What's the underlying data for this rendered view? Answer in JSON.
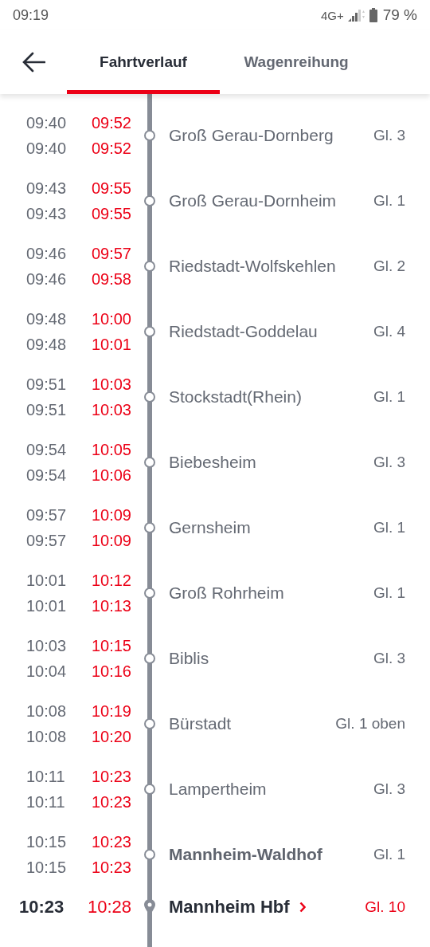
{
  "status_bar": {
    "time": "09:19",
    "network": "4G+",
    "battery": "79 %"
  },
  "tabs": [
    {
      "label": "Fahrtverlauf",
      "selected": true
    },
    {
      "label": "Wagenreihung",
      "selected": false
    }
  ],
  "stops": [
    {
      "kind": "stop",
      "arrival_planned": "09:40",
      "arrival_actual": "09:52",
      "departure_planned": "09:40",
      "departure_actual": "09:52",
      "name": "Groß Gerau-Dornberg",
      "platform": "Gl. 3",
      "platform_changed": false
    },
    {
      "kind": "stop",
      "arrival_planned": "09:43",
      "arrival_actual": "09:55",
      "departure_planned": "09:43",
      "departure_actual": "09:55",
      "name": "Groß Gerau-Dornheim",
      "platform": "Gl. 1",
      "platform_changed": false
    },
    {
      "kind": "stop",
      "arrival_planned": "09:46",
      "arrival_actual": "09:57",
      "departure_planned": "09:46",
      "departure_actual": "09:58",
      "name": "Riedstadt-Wolfskehlen",
      "platform": "Gl. 2",
      "platform_changed": false
    },
    {
      "kind": "stop",
      "arrival_planned": "09:48",
      "arrival_actual": "10:00",
      "departure_planned": "09:48",
      "departure_actual": "10:01",
      "name": "Riedstadt-Goddelau",
      "platform": "Gl. 4",
      "platform_changed": false
    },
    {
      "kind": "stop",
      "arrival_planned": "09:51",
      "arrival_actual": "10:03",
      "departure_planned": "09:51",
      "departure_actual": "10:03",
      "name": "Stockstadt(Rhein)",
      "platform": "Gl. 1",
      "platform_changed": false
    },
    {
      "kind": "stop",
      "arrival_planned": "09:54",
      "arrival_actual": "10:05",
      "departure_planned": "09:54",
      "departure_actual": "10:06",
      "name": "Biebesheim",
      "platform": "Gl. 3",
      "platform_changed": false
    },
    {
      "kind": "stop",
      "arrival_planned": "09:57",
      "arrival_actual": "10:09",
      "departure_planned": "09:57",
      "departure_actual": "10:09",
      "name": "Gernsheim",
      "platform": "Gl. 1",
      "platform_changed": false
    },
    {
      "kind": "stop",
      "arrival_planned": "10:01",
      "arrival_actual": "10:12",
      "departure_planned": "10:01",
      "departure_actual": "10:13",
      "name": "Groß Rohrheim",
      "platform": "Gl. 1",
      "platform_changed": false
    },
    {
      "kind": "stop",
      "arrival_planned": "10:03",
      "arrival_actual": "10:15",
      "departure_planned": "10:04",
      "departure_actual": "10:16",
      "name": "Biblis",
      "platform": "Gl. 3",
      "platform_changed": false
    },
    {
      "kind": "stop",
      "arrival_planned": "10:08",
      "arrival_actual": "10:19",
      "departure_planned": "10:08",
      "departure_actual": "10:20",
      "name": "Bürstadt",
      "platform": "Gl. 1 oben",
      "platform_changed": false
    },
    {
      "kind": "stop",
      "arrival_planned": "10:11",
      "arrival_actual": "10:23",
      "departure_planned": "10:11",
      "departure_actual": "10:23",
      "name": "Lampertheim",
      "platform": "Gl. 3",
      "platform_changed": false
    },
    {
      "kind": "major",
      "arrival_planned": "10:15",
      "arrival_actual": "10:23",
      "departure_planned": "10:15",
      "departure_actual": "10:23",
      "name": "Mannheim-Waldhof",
      "platform": "Gl. 1",
      "platform_changed": false
    },
    {
      "kind": "destination",
      "arrival_planned": "10:23",
      "arrival_actual": "10:28",
      "name": "Mannheim Hbf",
      "platform": "Gl. 10",
      "platform_changed": true
    }
  ]
}
